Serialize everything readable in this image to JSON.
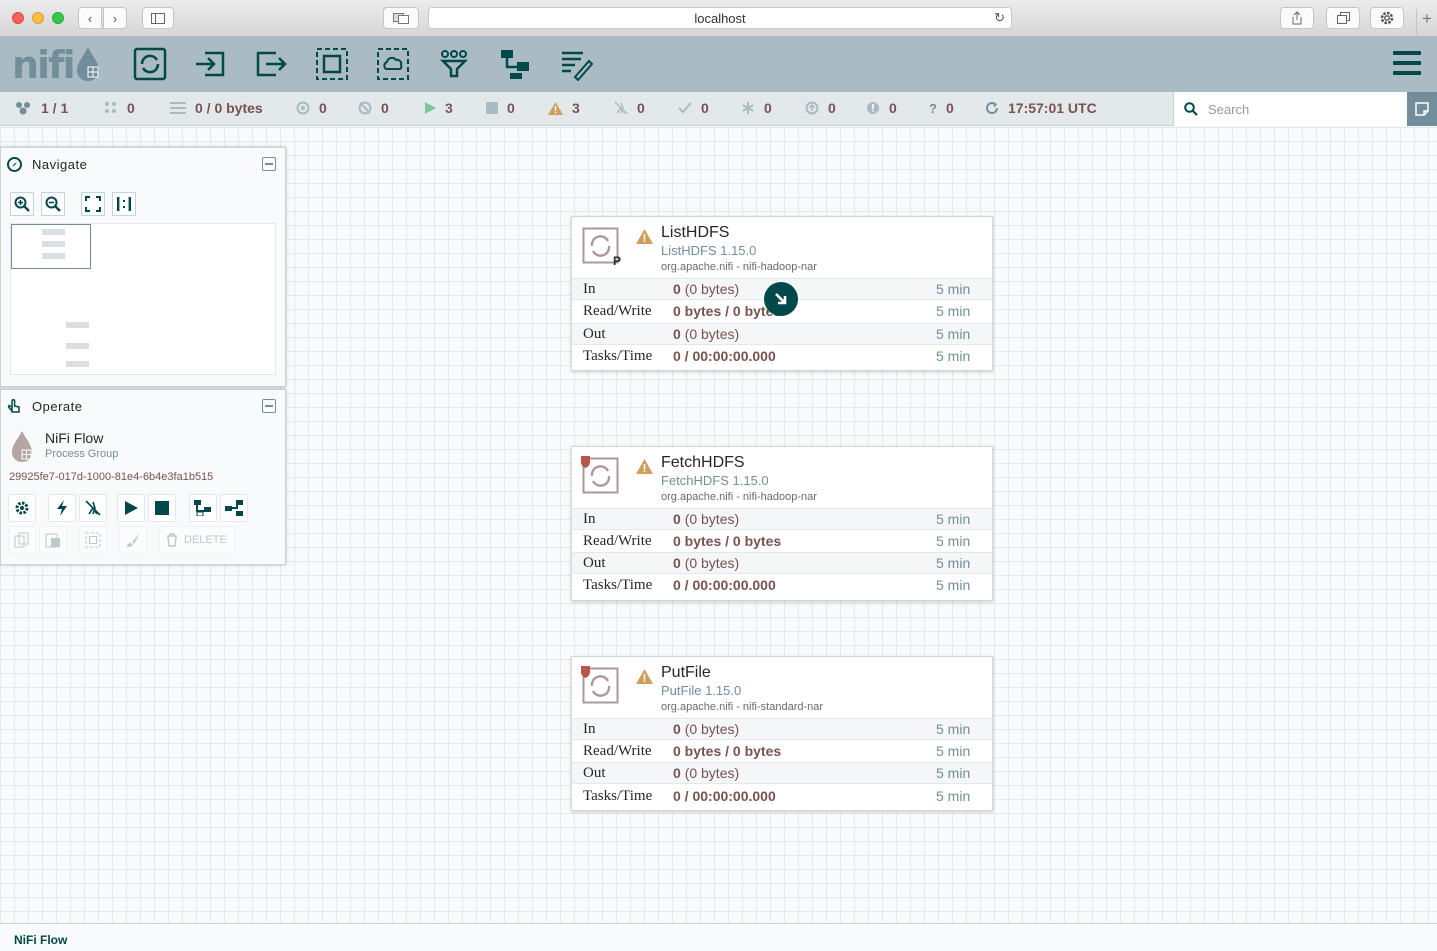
{
  "browser": {
    "url": "localhost"
  },
  "header": {
    "logo_text": "nifi",
    "toolbar": [
      "processor-icon",
      "input-port-icon",
      "output-port-icon",
      "process-group-icon",
      "remote-process-group-icon",
      "funnel-icon",
      "template-icon",
      "label-icon"
    ],
    "menu_icon": "hamburger-icon"
  },
  "status": {
    "cluster": "1 / 1",
    "threads": "0",
    "queued": "0 / 0 bytes",
    "transmitting": "0",
    "not_transmitting": "0",
    "running": "3",
    "stopped": "0",
    "invalid": "3",
    "disabled": "0",
    "up_to_date": "0",
    "locally_modified": "0",
    "stale": "0",
    "locally_modified_stale": "0",
    "sync_failure": "0",
    "last_refresh": "17:57:01 UTC",
    "search_placeholder": "Search"
  },
  "navigate": {
    "title": "Navigate"
  },
  "operate": {
    "title": "Operate",
    "name": "NiFi Flow",
    "type": "Process Group",
    "id": "29925fe7-017d-1000-81e4-6b4e3fa1b515",
    "delete_label": "DELETE"
  },
  "processors": [
    {
      "name": "ListHDFS",
      "type": "ListHDFS 1.15.0",
      "bundle": "org.apache.nifi - nifi-hadoop-nar",
      "primary_node": "P",
      "stats": [
        {
          "label": "In",
          "count": "0",
          "detail": "(0 bytes)",
          "time": "5 min"
        },
        {
          "label": "Read/Write",
          "count": "0 bytes / 0 bytes",
          "detail": "",
          "time": "5 min"
        },
        {
          "label": "Out",
          "count": "0",
          "detail": "(0 bytes)",
          "time": "5 min"
        },
        {
          "label": "Tasks/Time",
          "count": "0 / 00:00:00.000",
          "detail": "",
          "time": "5 min"
        }
      ]
    },
    {
      "name": "FetchHDFS",
      "type": "FetchHDFS 1.15.0",
      "bundle": "org.apache.nifi - nifi-hadoop-nar",
      "primary_node": "",
      "stats": [
        {
          "label": "In",
          "count": "0",
          "detail": "(0 bytes)",
          "time": "5 min"
        },
        {
          "label": "Read/Write",
          "count": "0 bytes / 0 bytes",
          "detail": "",
          "time": "5 min"
        },
        {
          "label": "Out",
          "count": "0",
          "detail": "(0 bytes)",
          "time": "5 min"
        },
        {
          "label": "Tasks/Time",
          "count": "0 / 00:00:00.000",
          "detail": "",
          "time": "5 min"
        }
      ]
    },
    {
      "name": "PutFile",
      "type": "PutFile 1.15.0",
      "bundle": "org.apache.nifi - nifi-standard-nar",
      "primary_node": "",
      "stats": [
        {
          "label": "In",
          "count": "0",
          "detail": "(0 bytes)",
          "time": "5 min"
        },
        {
          "label": "Read/Write",
          "count": "0 bytes / 0 bytes",
          "detail": "",
          "time": "5 min"
        },
        {
          "label": "Out",
          "count": "0",
          "detail": "(0 bytes)",
          "time": "5 min"
        },
        {
          "label": "Tasks/Time",
          "count": "0 / 00:00:00.000",
          "detail": "",
          "time": "5 min"
        }
      ]
    }
  ],
  "breadcrumb": "NiFi Flow",
  "colors": {
    "header_bg": "#aabbc3",
    "toolbar_icon": "#004849",
    "status_value": "#775351",
    "muted": "#728e9b",
    "warning": "#cf9f5d",
    "running": "#7dc7a0"
  }
}
